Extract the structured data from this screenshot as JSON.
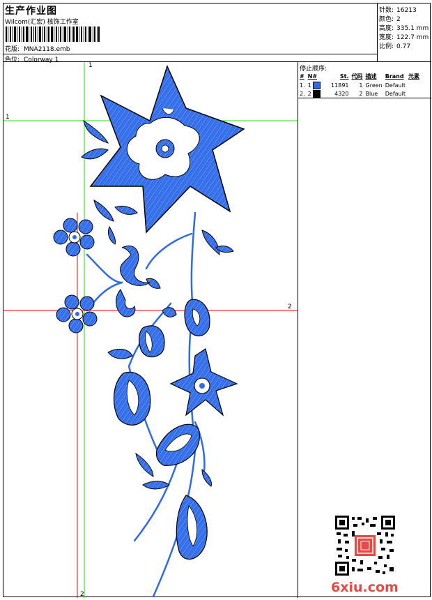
{
  "header": {
    "title": "生产作业图",
    "company": "Wilcom(汇宏) 核饰工作室",
    "design_label": "花版:",
    "design_value": "MNA2118.emb",
    "colorway_label": "色位:",
    "colorway_value": "Colorway 1"
  },
  "stats": [
    {
      "label": "针数:",
      "value": "16213"
    },
    {
      "label": "颜色:",
      "value": "2"
    },
    {
      "label": "高度:",
      "value": "335.1 mm"
    },
    {
      "label": "宽度:",
      "value": "122.7 mm"
    },
    {
      "label": "比例:",
      "value": "0.77"
    }
  ],
  "stop_sequence": {
    "title": "停止顺序:",
    "columns": [
      "#",
      "N#",
      "St.",
      "代码",
      "描述",
      "Brand",
      "元素"
    ],
    "rows": [
      {
        "num": "1.",
        "n": "1",
        "st": "11891",
        "code": "1",
        "desc": "Green",
        "brand": "Default",
        "swatch": "#2f6be8"
      },
      {
        "num": "2.",
        "n": "2",
        "st": "4320",
        "code": "2",
        "desc": "Blue",
        "brand": "Default",
        "swatch": "#000000"
      }
    ]
  },
  "guides": {
    "green_label_top": "1",
    "green_label_left": "1",
    "red_label_right": "2",
    "red_label_bottom": "2"
  },
  "watermark": "6xiu.com",
  "colors": {
    "thread_blue": "#2f6be8",
    "outline": "#000000",
    "green_guide": "#22dd22",
    "red_guide": "#ff0000",
    "brand_red": "#e74a45"
  }
}
